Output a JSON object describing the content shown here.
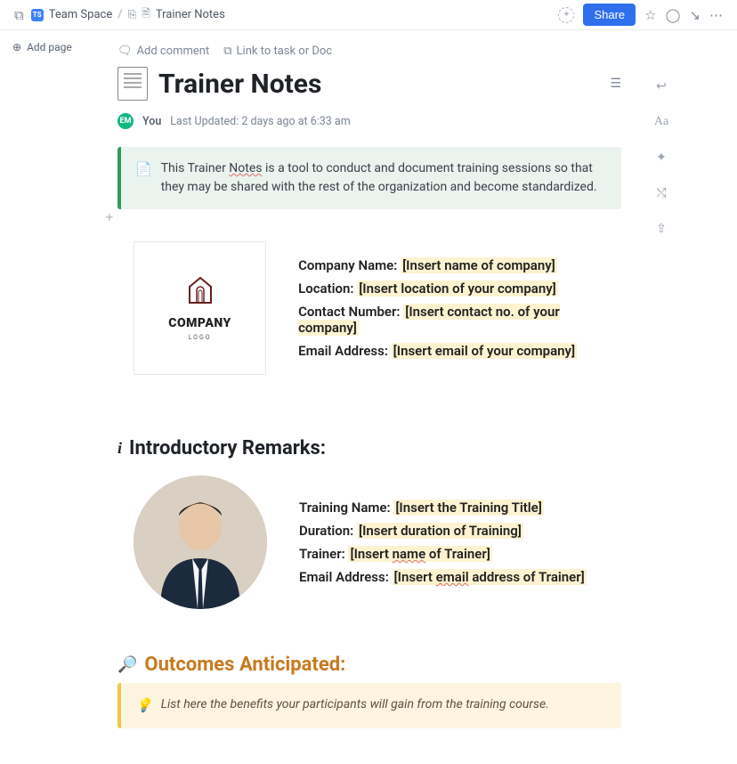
{
  "topbar": {
    "space": "Team Space",
    "doc_title": "Trainer Notes",
    "share": "Share"
  },
  "sidebar": {
    "add_page": "Add page"
  },
  "doc_actions": {
    "add_comment": "Add comment",
    "link_task": "Link to task or Doc"
  },
  "page": {
    "title": "Trainer Notes"
  },
  "meta": {
    "avatar_initials": "EM",
    "author": "You",
    "updated": "Last Updated: 2 days ago at 6:33 am"
  },
  "intro_callout": {
    "emoji": "📄",
    "text_a": "This Trainer ",
    "text_link": "Notes",
    "text_b": " is a tool to conduct and document training sessions so that they may be shared with the rest of the organization and become standardized."
  },
  "company": {
    "logo_word": "COMPANY",
    "logo_sub": "LOGO",
    "fields": {
      "name_label": "Company Name: ",
      "name_value": "[Insert name of company]",
      "location_label": "Location: ",
      "location_value": "[Insert location of your company]",
      "contact_label": "Contact Number: ",
      "contact_value": "[Insert contact no. of your company]",
      "email_label": "Email Address: ",
      "email_value": "[Insert email of your company]"
    }
  },
  "intro_section": {
    "heading": "Introductory Remarks:"
  },
  "training": {
    "name_label": "Training Name: ",
    "name_value": "[Insert the Training Title]",
    "duration_label": "Duration: ",
    "duration_value": "[Insert duration of Training]",
    "trainer_label": "Trainer: ",
    "trainer_value_a": "[Insert ",
    "trainer_value_u": "name",
    "trainer_value_b": " of Trainer]",
    "email_label": "Email Address: ",
    "email_value_a": "[Insert ",
    "email_value_u": "email",
    "email_value_b": " address of Trainer]"
  },
  "outcomes": {
    "heading": "Outcomes Anticipated:",
    "emoji": "🔎",
    "callout_emoji": "💡",
    "callout_text": "List here the benefits your participants will gain from the training course."
  },
  "right_rail": {
    "aa": "Aa"
  }
}
